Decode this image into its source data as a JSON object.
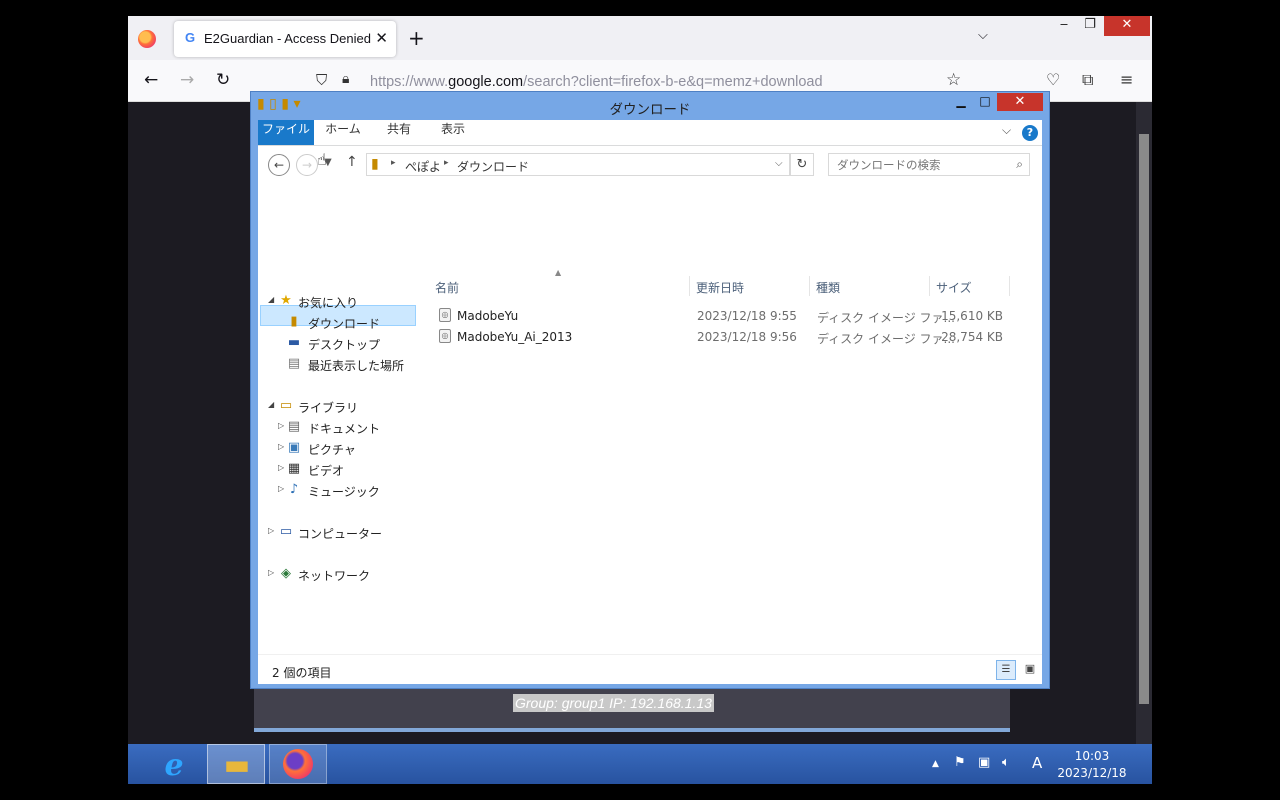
{
  "browser": {
    "tab_title": "E2Guardian - Access Denied",
    "tab_favicon": "G",
    "url_prefix": "https://www.",
    "url_host": "google.com",
    "url_rest": "/search?client=firefox-b-e&q=memz+download",
    "blocked_info": "Group: group1   IP: 192.168.1.13"
  },
  "explorer": {
    "title": "ダウンロード",
    "ribbon_tabs": [
      "ファイル",
      "ホーム",
      "共有",
      "表示"
    ],
    "breadcrumb": [
      "ぺぽよ",
      "ダウンロード"
    ],
    "search_placeholder": "ダウンロードの検索",
    "nav": {
      "favorites": "お気に入り",
      "downloads": "ダウンロード",
      "desktop": "デスクトップ",
      "recent": "最近表示した場所",
      "libraries": "ライブラリ",
      "documents": "ドキュメント",
      "pictures": "ピクチャ",
      "videos": "ビデオ",
      "music": "ミュージック",
      "computer": "コンピューター",
      "network": "ネットワーク"
    },
    "columns": [
      "名前",
      "更新日時",
      "種類",
      "サイズ"
    ],
    "files": [
      {
        "name": "MadobeYu",
        "date": "2023/12/18 9:55",
        "type": "ディスク イメージ ファ...",
        "size": "15,610 KB"
      },
      {
        "name": "MadobeYu_Ai_2013",
        "date": "2023/12/18 9:56",
        "type": "ディスク イメージ ファ...",
        "size": "28,754 KB"
      }
    ],
    "status": "2 個の項目"
  },
  "taskbar": {
    "time": "10:03",
    "date": "2023/12/18",
    "ime": "A"
  },
  "colors": {
    "window_frame": "#76a7e6",
    "file_tab": "#1979ca",
    "taskbar": "#2c5aa4",
    "close": "#c7342b"
  }
}
